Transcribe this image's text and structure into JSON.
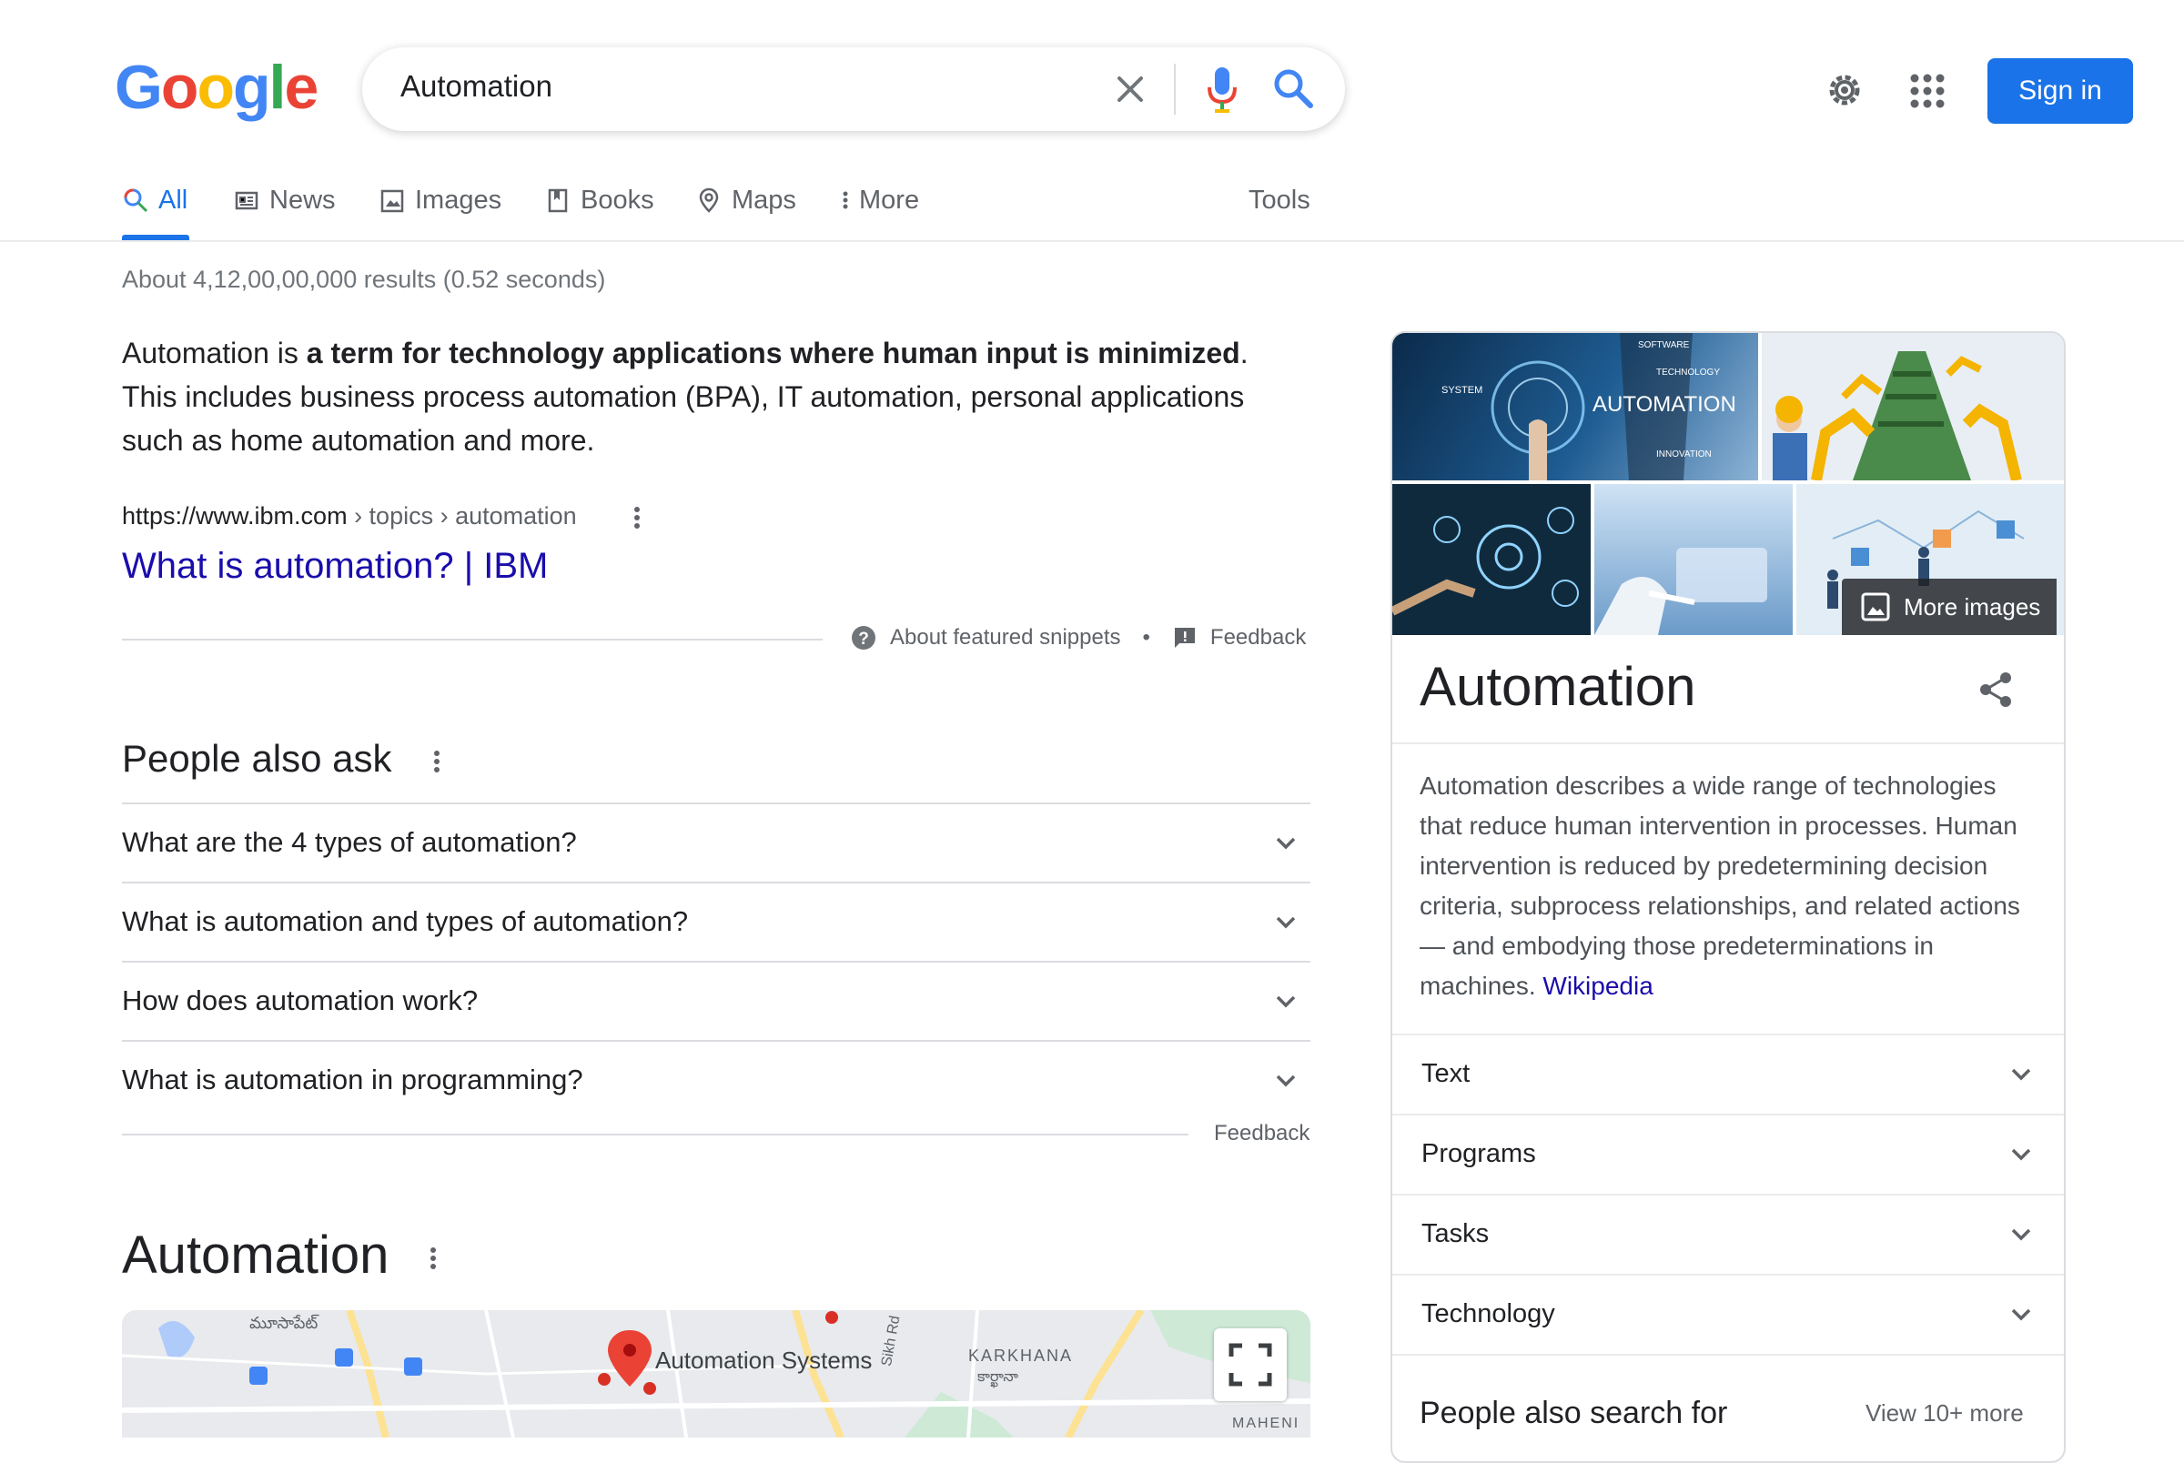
{
  "logo": {
    "letters": [
      "G",
      "o",
      "o",
      "g",
      "l",
      "e"
    ],
    "colors": [
      "#4285F4",
      "#EA4335",
      "#FBBC05",
      "#4285F4",
      "#34A853",
      "#EA4335"
    ]
  },
  "search": {
    "value": "Automation"
  },
  "header": {
    "sign_in": "Sign in"
  },
  "tabs": [
    {
      "label": "All",
      "icon": "search-icon",
      "active": true
    },
    {
      "label": "News",
      "icon": "newspaper-icon"
    },
    {
      "label": "Images",
      "icon": "image-icon"
    },
    {
      "label": "Books",
      "icon": "book-icon"
    },
    {
      "label": "Maps",
      "icon": "map-pin-icon"
    },
    {
      "label": "More",
      "icon": "kebab-icon"
    }
  ],
  "tools_label": "Tools",
  "stats": "About 4,12,00,00,000 results (0.52 seconds)",
  "snippet": {
    "pre": "Automation is ",
    "bold": "a term for technology applications where human input is minimized",
    "post": ". This includes business process automation (BPA), IT automation, personal applications such as home automation and more.",
    "cite_domain": "https://www.ibm.com",
    "cite_crumbs": " › topics › automation",
    "title": "What is automation? | IBM",
    "about_label": "About featured snippets",
    "feedback_label": "Feedback"
  },
  "paa": {
    "title": "People also ask",
    "questions": [
      "What are the 4 types of automation?",
      "What is automation and types of automation?",
      "How does automation work?",
      "What is automation in programming?"
    ],
    "feedback_label": "Feedback"
  },
  "local": {
    "title": "Automation",
    "map_label": "Automation Systems",
    "map_labels": [
      "మూసాపేట్",
      "Sikh Rd",
      "KARKHANA",
      "కార్ఖానా",
      "MAHENI"
    ]
  },
  "kp": {
    "more_images": "More images",
    "image_captions": [
      "SYSTEM",
      "SOFTWARE",
      "TECHNOLOGY",
      "AUTOMATION",
      "INNOVATION"
    ],
    "title": "Automation",
    "description": "Automation describes a wide range of technologies that reduce human intervention in processes. Human intervention is reduced by predetermining decision criteria, subprocess relationships, and related actions — and embodying those predeterminations in machines. ",
    "source": "Wikipedia",
    "rows": [
      "Text",
      "Programs",
      "Tasks",
      "Technology"
    ],
    "pasf": "People also search for",
    "view_more": "View 10+ more"
  }
}
